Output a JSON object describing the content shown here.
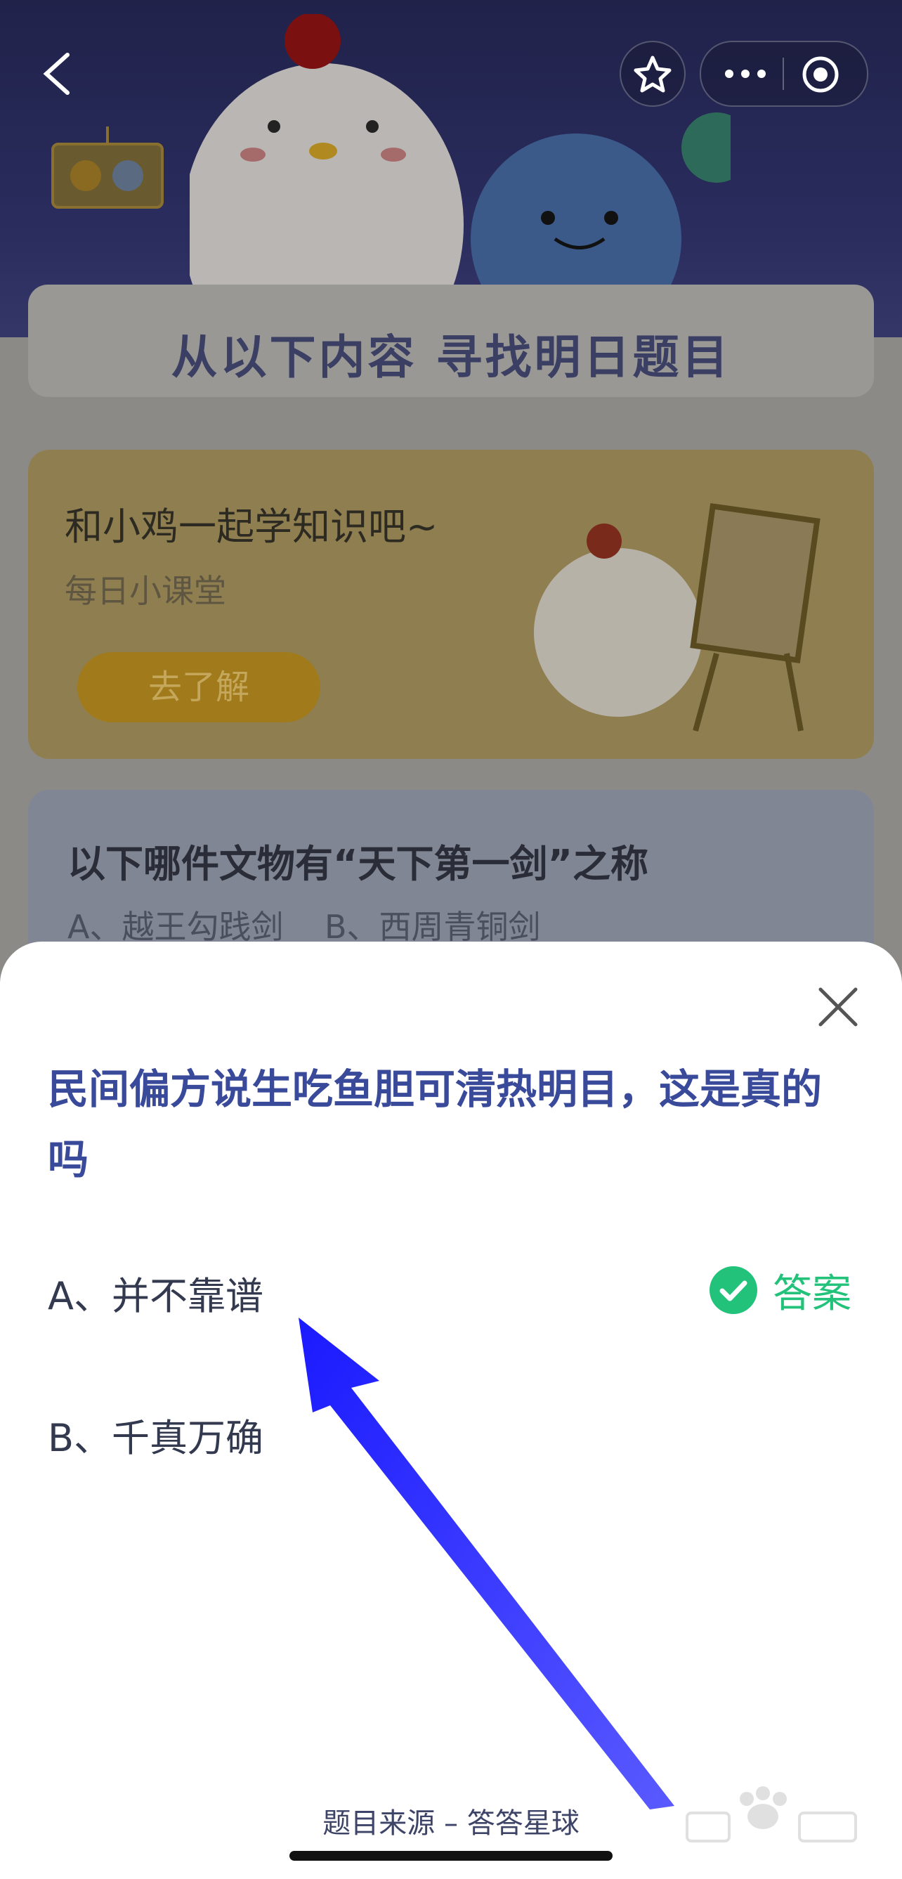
{
  "banner": {
    "title": "从以下内容 寻找明日题目"
  },
  "card_learn": {
    "title": "和小鸡一起学知识吧~",
    "subtitle": "每日小课堂",
    "button_label": "去了解"
  },
  "card_quiz": {
    "title": "以下哪件文物有“天下第一剑”之称",
    "option_a": "A、越王勾践剑",
    "option_b": "B、西周青铜剑"
  },
  "sheet": {
    "question": "民间偏方说生吃鱼胆可清热明目，这是真的吗",
    "option_a": "A、并不靠谱",
    "option_b": "B、千真万确",
    "answer_label": "答案",
    "footer": "题目来源 – 答答星球"
  },
  "colors": {
    "question": "#3a4a9a",
    "answer": "#22c27a",
    "arrow": "#1a1aff"
  },
  "icons": [
    "back-icon",
    "star-icon",
    "more-icon",
    "target-icon",
    "close-icon",
    "check-icon"
  ]
}
